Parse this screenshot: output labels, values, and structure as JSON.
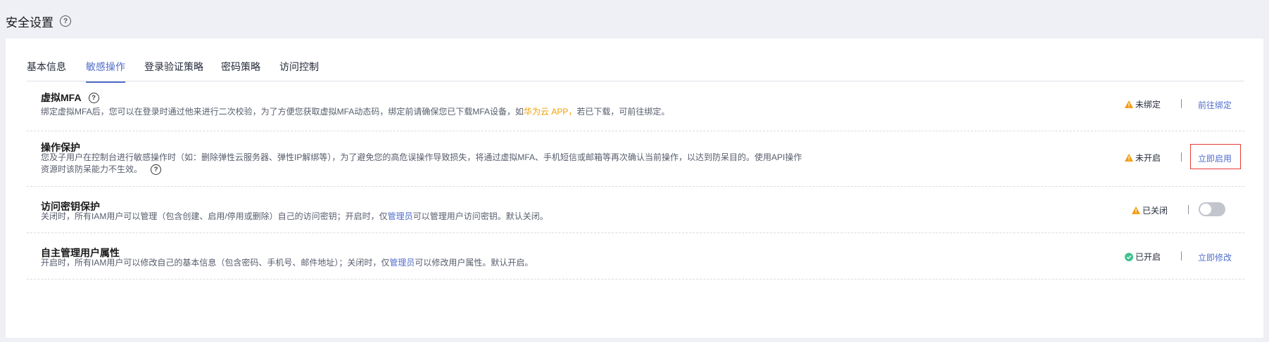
{
  "page": {
    "title": "安全设置"
  },
  "tabs": [
    {
      "label": "基本信息"
    },
    {
      "label": "敏感操作"
    },
    {
      "label": "登录验证策略"
    },
    {
      "label": "密码策略"
    },
    {
      "label": "访问控制"
    }
  ],
  "active_tab": "敏感操作",
  "rows": {
    "mfa": {
      "title": "虚拟MFA",
      "desc_1": "绑定虚拟MFA后，您可以在登录时通过他来进行二次校验，为了方便您获取虚拟MFA动态码，绑定前请确保您已下载MFA设备，如",
      "desc_link": "华为云 APP，",
      "desc_2": "若已下载，可前往绑定。",
      "status": "未绑定",
      "action": "前往绑定"
    },
    "op_protect": {
      "title": "操作保护",
      "desc_line1": "您及子用户在控制台进行敏感操作时（如：删除弹性云服务器、弹性IP解绑等），为了避免您的高危误操作导致损失，将通过虚拟MFA、手机短信或邮箱等再次确认当前操作，以达到防呆目的。使用API操作",
      "desc_line2": "资源时该防呆能力不生效。",
      "status": "未开启",
      "action": "立即启用"
    },
    "key_protect": {
      "title": "访问密钥保护",
      "desc_1": "关闭时，所有IAM用户可以管理（包含创建、启用/停用或删除）自己的访问密钥；开启时，仅",
      "desc_link": "管理员",
      "desc_2": "可以管理用户访问密钥。默认关闭。",
      "status": "已关闭",
      "toggle_on": false
    },
    "self_manage": {
      "title": "自主管理用户属性",
      "desc_1": "开启时，所有IAM用户可以修改自己的基本信息（包含密码、手机号、邮件地址）；关闭时，仅",
      "desc_link": "管理员",
      "desc_2": "可以修改用户属性。默认开启。",
      "status": "已开启",
      "action": "立即修改"
    }
  },
  "colors": {
    "accent": "#526ecc",
    "warning": "#f39c12",
    "success": "#3ec28f",
    "highlight": "#e53935"
  },
  "icons": {
    "help": "question-circle-icon",
    "warning": "warning-triangle-icon",
    "success": "check-circle-icon"
  }
}
